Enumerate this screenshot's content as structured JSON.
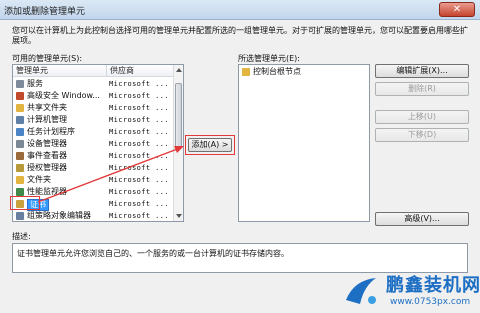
{
  "window": {
    "title": "添加或删除管理单元",
    "close_glyph": "✕"
  },
  "description": "您可以在计算机上为此控制台选择可用的管理单元并配置所选的一组管理单元。对于可扩展的管理单元，您可以配置要启用哪些扩展项。",
  "available": {
    "label": "可用的管理单元(S):",
    "columns": [
      "管理单元",
      "供应商"
    ],
    "items": [
      {
        "name": "服务",
        "vendor": "Microsoft ...",
        "icon": "services-icon",
        "color": "#7d8b9a"
      },
      {
        "name": "高级安全 Window...",
        "vendor": "Microsoft ...",
        "icon": "firewall-icon",
        "color": "#c24a2c"
      },
      {
        "name": "共享文件夹",
        "vendor": "Microsoft ...",
        "icon": "folder-icon",
        "color": "#e2b440"
      },
      {
        "name": "计算机管理",
        "vendor": "Microsoft ...",
        "icon": "computer-icon",
        "color": "#5d7fa8"
      },
      {
        "name": "任务计划程序",
        "vendor": "Microsoft ...",
        "icon": "clock-icon",
        "color": "#4a86c7"
      },
      {
        "name": "设备管理器",
        "vendor": "Microsoft ...",
        "icon": "device-icon",
        "color": "#7a8794"
      },
      {
        "name": "事件查看器",
        "vendor": "Microsoft ...",
        "icon": "event-icon",
        "color": "#9a6b3c"
      },
      {
        "name": "授权管理器",
        "vendor": "Microsoft ...",
        "icon": "key-icon",
        "color": "#b89a3c"
      },
      {
        "name": "文件夹",
        "vendor": "Microsoft ...",
        "icon": "folder-icon",
        "color": "#e2b440"
      },
      {
        "name": "性能监视器",
        "vendor": "Microsoft ...",
        "icon": "chart-icon",
        "color": "#3f8a4a"
      },
      {
        "name": "证书",
        "vendor": "Microsoft ...",
        "icon": "certificate-icon",
        "color": "#c9a23e",
        "selected": true
      },
      {
        "name": "组策略对象编辑器",
        "vendor": "Microsoft ...",
        "icon": "policy-icon",
        "color": "#6a7fa0"
      }
    ]
  },
  "add_button": "添加(A) >",
  "selected": {
    "label": "所选管理单元(E):",
    "items": [
      {
        "name": "控制台根节点",
        "icon": "folder-icon"
      }
    ]
  },
  "buttons": {
    "edit_extensions": "编辑扩展(X)...",
    "remove": "删除(R)",
    "move_up": "上移(U)",
    "move_down": "下移(D)",
    "advanced": "高级(V)..."
  },
  "description_section": {
    "label": "描述:",
    "text": "证书管理单元允许您浏览自己的、一个服务的或一台计算机的证书存储内容。"
  },
  "watermark": {
    "brand": "鹏鑫装机网",
    "url": "www.0753px.com"
  },
  "colors": {
    "highlight": "#e23a3a",
    "selection": "#3399ff",
    "brand": "#1d6fc4"
  }
}
